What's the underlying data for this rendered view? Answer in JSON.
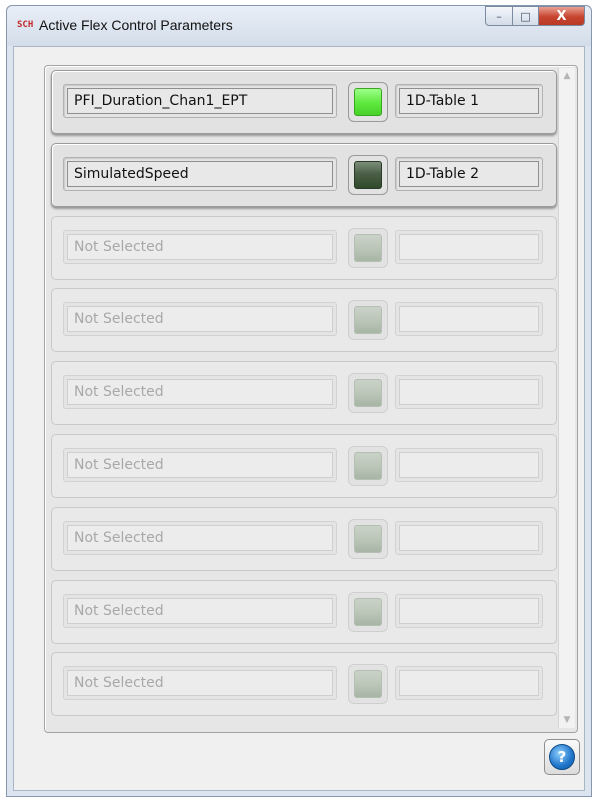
{
  "window": {
    "title": "Active Flex Control Parameters",
    "app_icon": "SCH",
    "minimize_glyph": "–",
    "maximize_glyph": "□",
    "close_glyph": "X"
  },
  "scrollbar": {
    "up_glyph": "▲",
    "down_glyph": "▼"
  },
  "rows": [
    {
      "parameter": "PFI_Duration_Chan1_EPT",
      "table": "1D-Table 1",
      "led": "on",
      "active": true
    },
    {
      "parameter": "SimulatedSpeed",
      "table": "1D-Table 2",
      "led": "off",
      "active": true
    },
    {
      "parameter": "Not Selected",
      "table": "",
      "led": "disabled",
      "active": false
    },
    {
      "parameter": "Not Selected",
      "table": "",
      "led": "disabled",
      "active": false
    },
    {
      "parameter": "Not Selected",
      "table": "",
      "led": "disabled",
      "active": false
    },
    {
      "parameter": "Not Selected",
      "table": "",
      "led": "disabled",
      "active": false
    },
    {
      "parameter": "Not Selected",
      "table": "",
      "led": "disabled",
      "active": false
    },
    {
      "parameter": "Not Selected",
      "table": "",
      "led": "disabled",
      "active": false
    },
    {
      "parameter": "Not Selected",
      "table": "",
      "led": "disabled",
      "active": false
    }
  ],
  "help_button": {
    "glyph": "?"
  },
  "colors": {
    "led_on": "#5de83d",
    "led_off": "#3d5539",
    "led_disabled": "#bcc7ba",
    "close_button": "#c7442e",
    "help_icon": "#1e74c9"
  }
}
